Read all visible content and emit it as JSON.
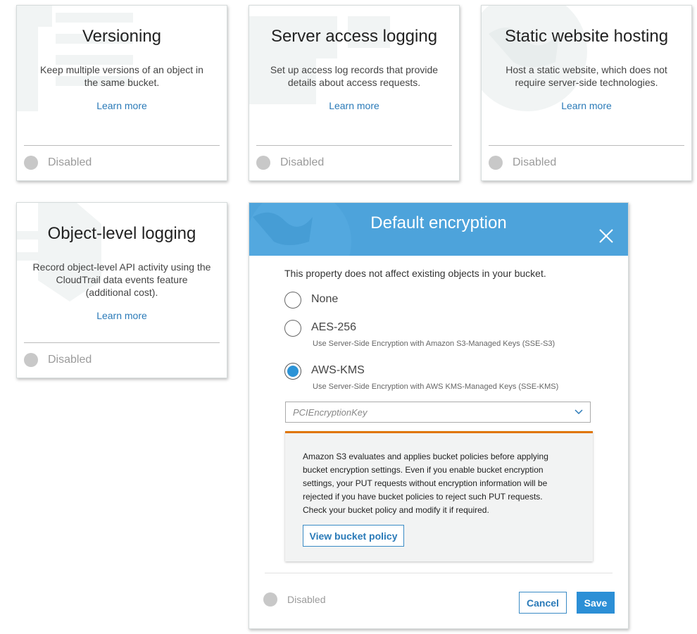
{
  "cards": [
    {
      "title": "Versioning",
      "description": "Keep multiple versions of an object in the same bucket.",
      "learn_more": "Learn more",
      "status": "Disabled",
      "icon": "versioning-icon"
    },
    {
      "title": "Server access logging",
      "description": "Set up access log records that provide details about access requests.",
      "learn_more": "Learn more",
      "status": "Disabled",
      "icon": "logging-icon"
    },
    {
      "title": "Static website hosting",
      "description": "Host a static website, which does not require server-side technologies.",
      "learn_more": "Learn more",
      "status": "Disabled",
      "icon": "globe-icon"
    },
    {
      "title": "Object-level logging",
      "description": "Record object-level API activity using the CloudTrail data events feature (additional cost).",
      "learn_more": "Learn more",
      "status": "Disabled",
      "icon": "object-logging-icon"
    }
  ],
  "encryption_modal": {
    "title": "Default encryption",
    "intro": "This property does not affect existing objects in your bucket.",
    "options": [
      {
        "label": "None",
        "sub": "",
        "selected": false
      },
      {
        "label": "AES-256",
        "sub": "Use Server-Side Encryption with Amazon S3-Managed Keys (SSE-S3)",
        "selected": false
      },
      {
        "label": "AWS-KMS",
        "sub": "Use Server-Side Encryption with AWS KMS-Managed Keys (SSE-KMS)",
        "selected": true
      }
    ],
    "kms_key_select": "PCIEncryptionKey",
    "warning": "Amazon S3 evaluates and applies bucket policies before applying bucket encryption settings. Even if you enable bucket encryption settings, your PUT requests without encryption information will be rejected if you have bucket policies to reject such PUT requests. Check your bucket policy and modify it if required.",
    "view_policy_button": "View bucket policy",
    "status": "Disabled",
    "cancel_button": "Cancel",
    "save_button": "Save"
  },
  "colors": {
    "accent": "#2c8fd6",
    "header": "#4da3db",
    "warning_border": "#e07500",
    "disabled_dot": "#c8c8c8"
  }
}
